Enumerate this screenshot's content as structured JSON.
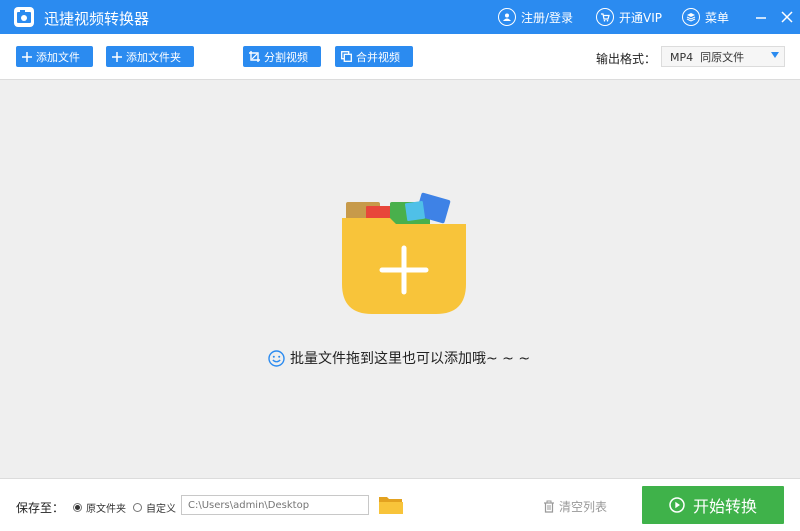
{
  "app": {
    "title": "迅捷视频转换器",
    "register_login": "注册/登录",
    "vip": "开通VIP",
    "menu": "菜单"
  },
  "toolbar": {
    "add_file": "添加文件",
    "add_folder": "添加文件夹",
    "split_video": "分割视频",
    "merge_video": "合并视频",
    "output_format_label": "输出格式：",
    "output_format_value": "MP4  同原文件"
  },
  "drop": {
    "hint": "批量文件拖到这里也可以添加哦~ ~ ~"
  },
  "bottom": {
    "save_to": "保存至：",
    "option_original": "原文件夹",
    "option_custom": "自定义",
    "path_placeholder": "C:\\Users\\admin\\Desktop",
    "clear_list": "清空列表",
    "start": "开始转换"
  },
  "colors": {
    "accent": "#2b8bf0",
    "start_green": "#3fb24a",
    "folder_yellow": "#f8c43a"
  }
}
